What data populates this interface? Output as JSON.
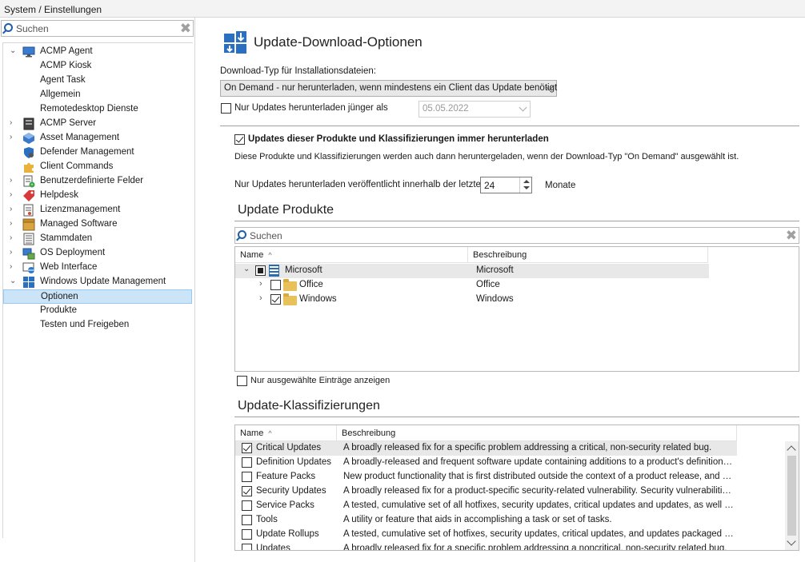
{
  "breadcrumb": "System / Einstellungen",
  "sidebar": {
    "search_placeholder": "Suchen",
    "items": [
      {
        "label": "ACMP Agent",
        "icon": "monitor-icon",
        "expanded": true
      },
      {
        "label": "ACMP Kiosk"
      },
      {
        "label": "Agent Task"
      },
      {
        "label": "Allgemein"
      },
      {
        "label": "Remotedesktop Dienste"
      },
      {
        "label": "ACMP Server",
        "icon": "server-icon"
      },
      {
        "label": "Asset Management",
        "icon": "cube-icon"
      },
      {
        "label": "Defender Management",
        "icon": "shield-icon"
      },
      {
        "label": "Client Commands",
        "icon": "puzzle-icon"
      },
      {
        "label": "Benutzerdefinierte Felder",
        "icon": "form-plus-icon"
      },
      {
        "label": "Helpdesk",
        "icon": "tag-icon"
      },
      {
        "label": "Lizenzmanagement",
        "icon": "license-icon"
      },
      {
        "label": "Managed Software",
        "icon": "package-icon"
      },
      {
        "label": "Stammdaten",
        "icon": "list-icon"
      },
      {
        "label": "OS Deployment",
        "icon": "deploy-icon"
      },
      {
        "label": "Web Interface",
        "icon": "globe-icon"
      },
      {
        "label": "Windows Update Management",
        "icon": "windows-update-icon",
        "expanded": true
      },
      {
        "label": "Optionen",
        "selected": true
      },
      {
        "label": "Produkte"
      },
      {
        "label": "Testen und Freigeben"
      }
    ]
  },
  "main": {
    "title": "Update-Download-Optionen",
    "download_type_label": "Download-Typ für Installationsdateien:",
    "download_type_value": "On Demand - nur herunterladen, wenn mindestens ein Client das Update benötigt",
    "younger_than_label": "Nur Updates herunterladen jünger als",
    "younger_than_date": "05.05.2022",
    "always_download_label": "Updates dieser Produkte und Klassifizierungen immer herunterladen",
    "always_download_desc": "Diese Produkte und Klassifizierungen werden auch dann heruntergeladen, wenn der Download-Typ \"On Demand\" ausgewählt ist.",
    "months_label": "Nur Updates herunterladen veröffentlicht innerhalb der letzten",
    "months_value": "24",
    "months_unit": "Monate",
    "products_title": "Update Produkte",
    "products_search_placeholder": "Suchen",
    "products_columns": [
      "Name",
      "Beschreibung"
    ],
    "products_rows": [
      {
        "name": "Microsoft",
        "desc": "Microsoft"
      },
      {
        "name": "Office",
        "desc": "Office"
      },
      {
        "name": "Windows",
        "desc": "Windows"
      }
    ],
    "only_selected_label": "Nur ausgewählte Einträge anzeigen",
    "classifications_title": "Update-Klassifizierungen",
    "classifications_columns": [
      "Name",
      "Beschreibung"
    ],
    "classifications_rows": [
      {
        "name": "Critical Updates",
        "desc": "A broadly released fix for a specific problem addressing a critical, non-security related bug.",
        "checked": true
      },
      {
        "name": "Definition Updates",
        "desc": "A broadly-released and frequent software update containing additions to a product's definition dat...",
        "checked": false
      },
      {
        "name": "Feature Packs",
        "desc": "New product functionality that is first distributed outside the context of a product release, and usu...",
        "checked": false
      },
      {
        "name": "Security Updates",
        "desc": "A broadly released fix for a product-specific security-related vulnerability. Security vulnerabilities a...",
        "checked": true
      },
      {
        "name": "Service Packs",
        "desc": "A tested, cumulative set of all hotfixes, security updates, critical updates and updates, as well as ...",
        "checked": false
      },
      {
        "name": "Tools",
        "desc": "A utility or feature that aids in accomplishing a task or set of tasks.",
        "checked": false
      },
      {
        "name": "Update Rollups",
        "desc": "A tested, cumulative set of hotfixes, security updates, critical updates, and updates packaged tog...",
        "checked": false
      },
      {
        "name": "Updates",
        "desc": "A broadly released fix for a specific problem addressing a noncritical, non-security related bug.",
        "checked": false
      }
    ]
  }
}
